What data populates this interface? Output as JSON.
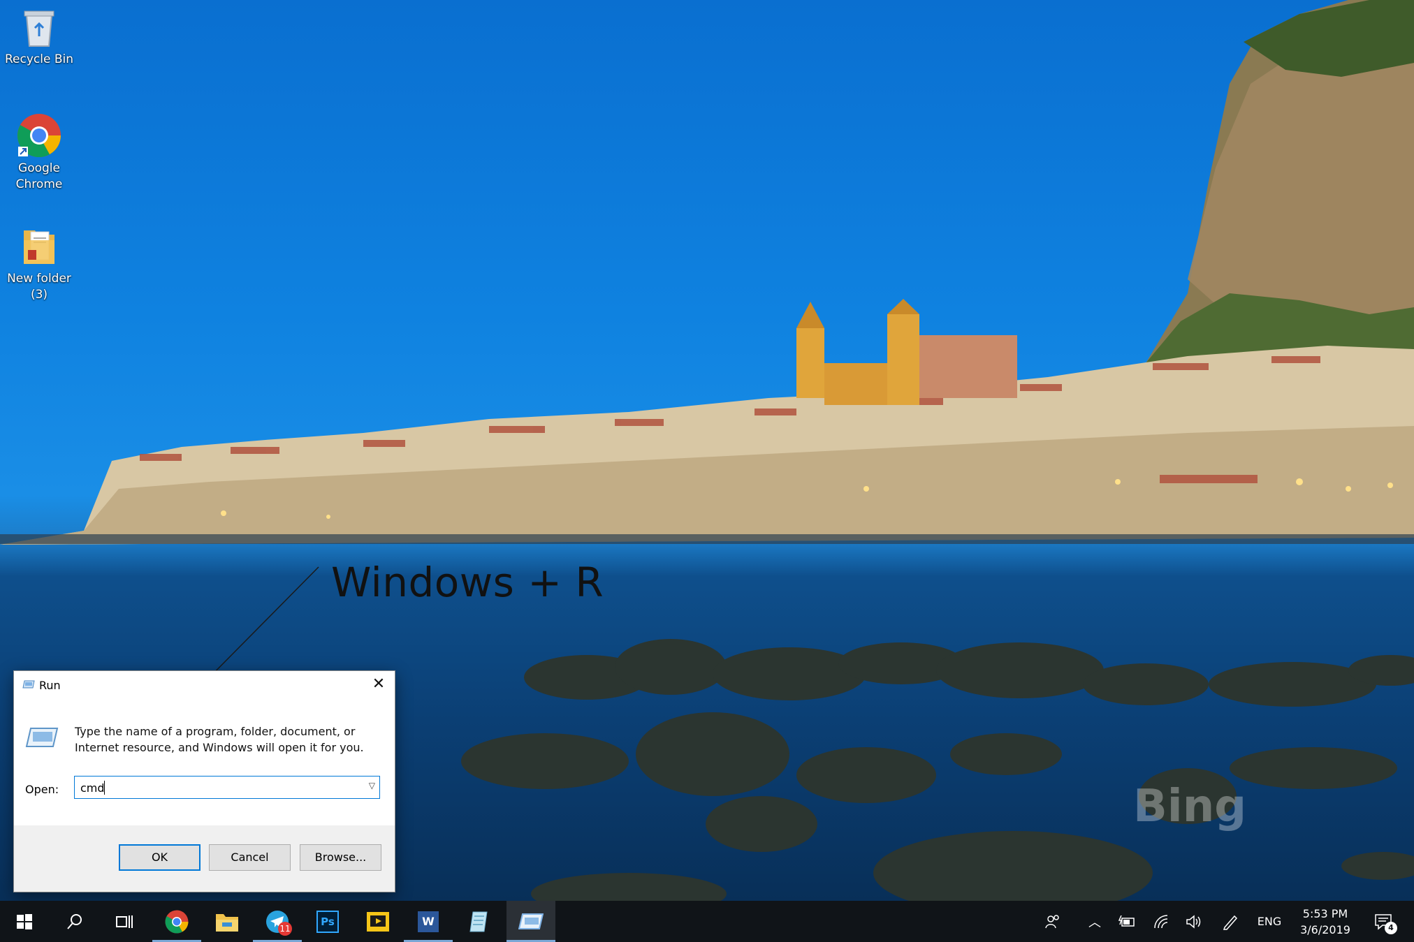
{
  "desktop": {
    "icons": [
      {
        "label": "Recycle Bin",
        "icon": "recycle-bin-icon"
      },
      {
        "label": "Google Chrome",
        "icon": "chrome-icon"
      },
      {
        "label": "New folder (3)",
        "icon": "folder-icon"
      }
    ],
    "annotation": "Windows + R",
    "watermark": "Bing"
  },
  "run_dialog": {
    "title": "Run",
    "description": "Type the name of a program, folder, document, or Internet resource, and Windows will open it for you.",
    "open_label": "Open:",
    "open_value": "cmd",
    "ok_label": "OK",
    "cancel_label": "Cancel",
    "browse_label": "Browse...",
    "close_icon": "close-icon"
  },
  "taskbar": {
    "apps": [
      {
        "icon": "windows-start-icon"
      },
      {
        "icon": "search-icon"
      },
      {
        "icon": "task-view-icon"
      },
      {
        "icon": "chrome-icon"
      },
      {
        "icon": "file-explorer-icon"
      },
      {
        "icon": "telegram-icon",
        "badge": "11"
      },
      {
        "icon": "photoshop-icon",
        "label": "Ps"
      },
      {
        "icon": "media-player-icon"
      },
      {
        "icon": "word-icon",
        "label": "W"
      },
      {
        "icon": "notepad-icon"
      },
      {
        "icon": "run-icon"
      }
    ],
    "tray": {
      "language": "ENG",
      "time": "5:53 PM",
      "date": "3/6/2019",
      "notification_count": "4"
    }
  },
  "colors": {
    "taskbar_bg": "#101418",
    "accent": "#0078d7",
    "telegram": "#2aa3de",
    "photoshop": "#31a8ff",
    "word": "#2b579a"
  }
}
